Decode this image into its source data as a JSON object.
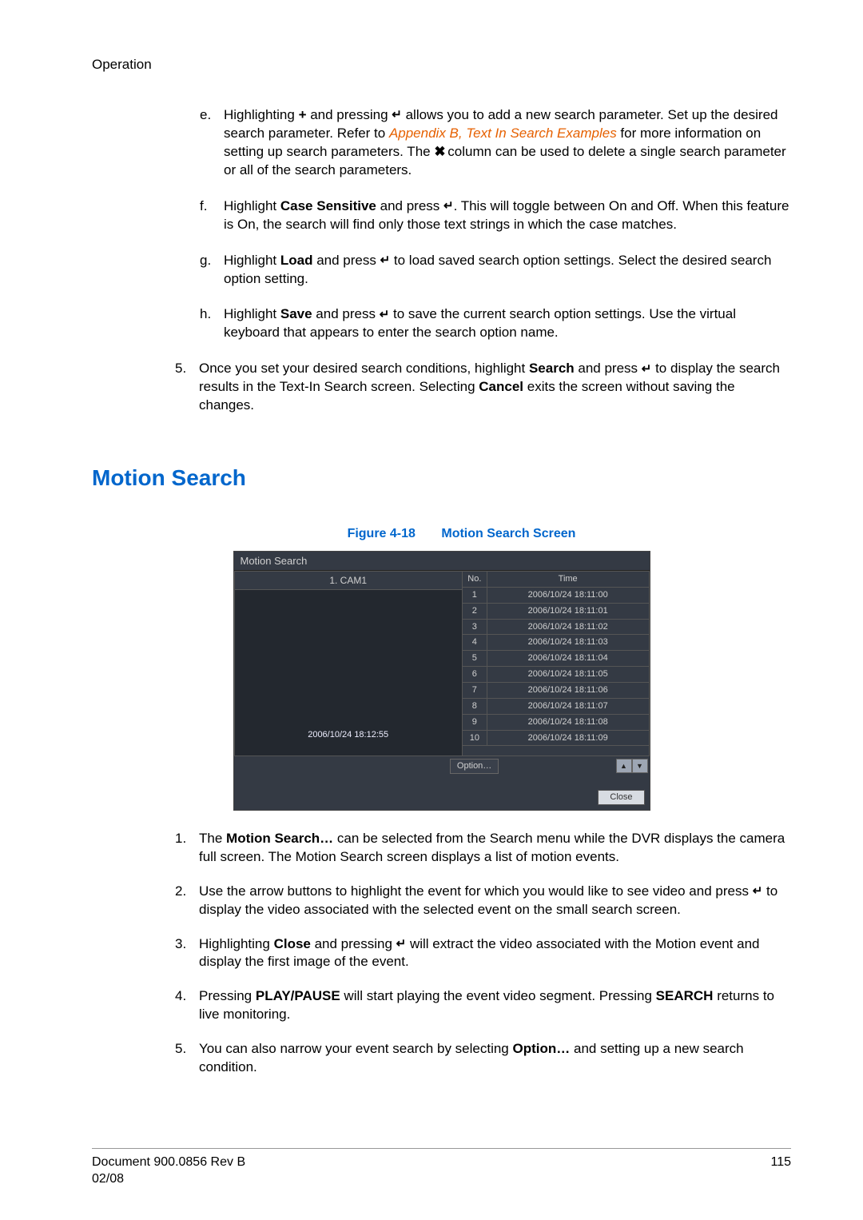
{
  "header": {
    "section": "Operation"
  },
  "sub_e": {
    "marker": "e.",
    "p1a": "Highlighting ",
    "plus": "+",
    "p1b": " and pressing ",
    "p1c": " allows you to add a new search parameter. Set up the desired search parameter. Refer to ",
    "link": "Appendix B, Text In Search Examples",
    "p1d": " for more information on setting up search parameters. The ",
    "p1e": " column can be used to delete a single search parameter or all of the search parameters."
  },
  "sub_f": {
    "marker": "f.",
    "pre": "Highlight ",
    "bold": "Case Sensitive",
    "mid": " and press ",
    "post": ". This will toggle between On and Off. When this feature is On, the search will find only those text strings in which the case matches."
  },
  "sub_g": {
    "marker": "g.",
    "pre": "Highlight ",
    "bold": "Load",
    "mid": " and press ",
    "post": " to load saved search option settings. Select the desired search option setting."
  },
  "sub_h": {
    "marker": "h.",
    "pre": "Highlight ",
    "bold": "Save",
    "mid": " and press ",
    "post": " to save the current search option settings. Use the virtual keyboard that appears to enter the search option name."
  },
  "num_5": {
    "marker": "5.",
    "pre": "Once you set your desired search conditions, highlight ",
    "bold1": "Search",
    "mid1": " and press ",
    "mid2": " to display the search results in the Text-In Search screen. Selecting ",
    "bold2": "Cancel",
    "post": " exits the screen without saving the changes."
  },
  "heading": "Motion Search",
  "figure": {
    "num": "Figure 4-18",
    "title": "Motion Search Screen"
  },
  "screenshot": {
    "title": "Motion Search",
    "cam": "1. CAM1",
    "preview_time": "2006/10/24  18:12:55",
    "no_head": "No.",
    "time_head": "Time",
    "rows": [
      {
        "no": "1",
        "time": "2006/10/24  18:11:00"
      },
      {
        "no": "2",
        "time": "2006/10/24  18:11:01"
      },
      {
        "no": "3",
        "time": "2006/10/24  18:11:02"
      },
      {
        "no": "4",
        "time": "2006/10/24  18:11:03"
      },
      {
        "no": "5",
        "time": "2006/10/24  18:11:04"
      },
      {
        "no": "6",
        "time": "2006/10/24  18:11:05"
      },
      {
        "no": "7",
        "time": "2006/10/24  18:11:06"
      },
      {
        "no": "8",
        "time": "2006/10/24  18:11:07"
      },
      {
        "no": "9",
        "time": "2006/10/24  18:11:08"
      },
      {
        "no": "10",
        "time": "2006/10/24  18:11:09"
      }
    ],
    "option": "Option…",
    "close": "Close"
  },
  "body_list": {
    "i1": {
      "marker": "1.",
      "pre": "The ",
      "bold": "Motion Search…",
      "post": " can be selected from the Search menu while the DVR displays the camera full screen. The Motion Search screen displays a list of motion events."
    },
    "i2": {
      "marker": "2.",
      "pre": "Use the arrow buttons to highlight the event for which you would like to see video and press ",
      "post": " to display the video associated with the selected event on the small search screen."
    },
    "i3": {
      "marker": "3.",
      "pre": "Highlighting ",
      "bold": "Close",
      "mid": " and pressing ",
      "post": " will extract the video associated with the Motion event and display the first image of the event."
    },
    "i4": {
      "marker": "4.",
      "pre": "Pressing ",
      "bold1": "PLAY/PAUSE",
      "mid": " will start playing the event video segment. Pressing ",
      "bold2": "SEARCH",
      "post": " returns to live monitoring."
    },
    "i5": {
      "marker": "5.",
      "pre": "You can also narrow your event search by selecting ",
      "bold": "Option…",
      "post": " and setting up a new search condition."
    }
  },
  "footer": {
    "doc": "Document 900.0856 Rev B",
    "date": "02/08",
    "page": "115"
  }
}
